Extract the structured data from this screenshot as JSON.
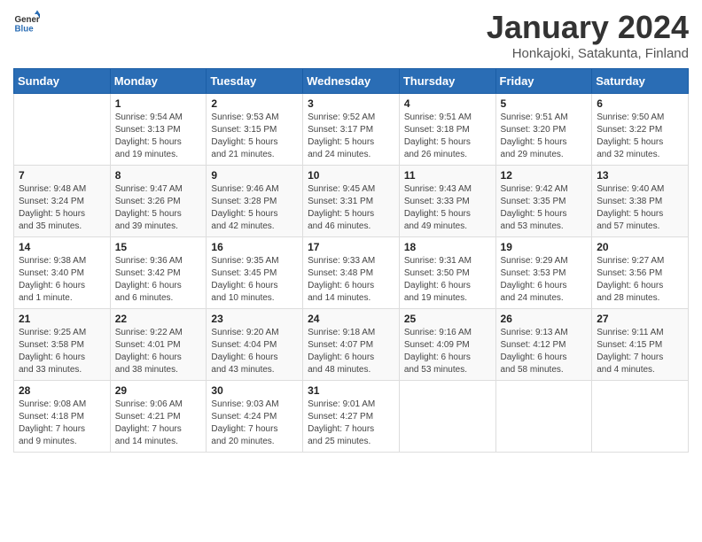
{
  "header": {
    "logo_general": "General",
    "logo_blue": "Blue",
    "title": "January 2024",
    "subtitle": "Honkajoki, Satakunta, Finland"
  },
  "calendar": {
    "days_of_week": [
      "Sunday",
      "Monday",
      "Tuesday",
      "Wednesday",
      "Thursday",
      "Friday",
      "Saturday"
    ],
    "weeks": [
      [
        {
          "day": "",
          "info": ""
        },
        {
          "day": "1",
          "info": "Sunrise: 9:54 AM\nSunset: 3:13 PM\nDaylight: 5 hours\nand 19 minutes."
        },
        {
          "day": "2",
          "info": "Sunrise: 9:53 AM\nSunset: 3:15 PM\nDaylight: 5 hours\nand 21 minutes."
        },
        {
          "day": "3",
          "info": "Sunrise: 9:52 AM\nSunset: 3:17 PM\nDaylight: 5 hours\nand 24 minutes."
        },
        {
          "day": "4",
          "info": "Sunrise: 9:51 AM\nSunset: 3:18 PM\nDaylight: 5 hours\nand 26 minutes."
        },
        {
          "day": "5",
          "info": "Sunrise: 9:51 AM\nSunset: 3:20 PM\nDaylight: 5 hours\nand 29 minutes."
        },
        {
          "day": "6",
          "info": "Sunrise: 9:50 AM\nSunset: 3:22 PM\nDaylight: 5 hours\nand 32 minutes."
        }
      ],
      [
        {
          "day": "7",
          "info": "Sunrise: 9:48 AM\nSunset: 3:24 PM\nDaylight: 5 hours\nand 35 minutes."
        },
        {
          "day": "8",
          "info": "Sunrise: 9:47 AM\nSunset: 3:26 PM\nDaylight: 5 hours\nand 39 minutes."
        },
        {
          "day": "9",
          "info": "Sunrise: 9:46 AM\nSunset: 3:28 PM\nDaylight: 5 hours\nand 42 minutes."
        },
        {
          "day": "10",
          "info": "Sunrise: 9:45 AM\nSunset: 3:31 PM\nDaylight: 5 hours\nand 46 minutes."
        },
        {
          "day": "11",
          "info": "Sunrise: 9:43 AM\nSunset: 3:33 PM\nDaylight: 5 hours\nand 49 minutes."
        },
        {
          "day": "12",
          "info": "Sunrise: 9:42 AM\nSunset: 3:35 PM\nDaylight: 5 hours\nand 53 minutes."
        },
        {
          "day": "13",
          "info": "Sunrise: 9:40 AM\nSunset: 3:38 PM\nDaylight: 5 hours\nand 57 minutes."
        }
      ],
      [
        {
          "day": "14",
          "info": "Sunrise: 9:38 AM\nSunset: 3:40 PM\nDaylight: 6 hours\nand 1 minute."
        },
        {
          "day": "15",
          "info": "Sunrise: 9:36 AM\nSunset: 3:42 PM\nDaylight: 6 hours\nand 6 minutes."
        },
        {
          "day": "16",
          "info": "Sunrise: 9:35 AM\nSunset: 3:45 PM\nDaylight: 6 hours\nand 10 minutes."
        },
        {
          "day": "17",
          "info": "Sunrise: 9:33 AM\nSunset: 3:48 PM\nDaylight: 6 hours\nand 14 minutes."
        },
        {
          "day": "18",
          "info": "Sunrise: 9:31 AM\nSunset: 3:50 PM\nDaylight: 6 hours\nand 19 minutes."
        },
        {
          "day": "19",
          "info": "Sunrise: 9:29 AM\nSunset: 3:53 PM\nDaylight: 6 hours\nand 24 minutes."
        },
        {
          "day": "20",
          "info": "Sunrise: 9:27 AM\nSunset: 3:56 PM\nDaylight: 6 hours\nand 28 minutes."
        }
      ],
      [
        {
          "day": "21",
          "info": "Sunrise: 9:25 AM\nSunset: 3:58 PM\nDaylight: 6 hours\nand 33 minutes."
        },
        {
          "day": "22",
          "info": "Sunrise: 9:22 AM\nSunset: 4:01 PM\nDaylight: 6 hours\nand 38 minutes."
        },
        {
          "day": "23",
          "info": "Sunrise: 9:20 AM\nSunset: 4:04 PM\nDaylight: 6 hours\nand 43 minutes."
        },
        {
          "day": "24",
          "info": "Sunrise: 9:18 AM\nSunset: 4:07 PM\nDaylight: 6 hours\nand 48 minutes."
        },
        {
          "day": "25",
          "info": "Sunrise: 9:16 AM\nSunset: 4:09 PM\nDaylight: 6 hours\nand 53 minutes."
        },
        {
          "day": "26",
          "info": "Sunrise: 9:13 AM\nSunset: 4:12 PM\nDaylight: 6 hours\nand 58 minutes."
        },
        {
          "day": "27",
          "info": "Sunrise: 9:11 AM\nSunset: 4:15 PM\nDaylight: 7 hours\nand 4 minutes."
        }
      ],
      [
        {
          "day": "28",
          "info": "Sunrise: 9:08 AM\nSunset: 4:18 PM\nDaylight: 7 hours\nand 9 minutes."
        },
        {
          "day": "29",
          "info": "Sunrise: 9:06 AM\nSunset: 4:21 PM\nDaylight: 7 hours\nand 14 minutes."
        },
        {
          "day": "30",
          "info": "Sunrise: 9:03 AM\nSunset: 4:24 PM\nDaylight: 7 hours\nand 20 minutes."
        },
        {
          "day": "31",
          "info": "Sunrise: 9:01 AM\nSunset: 4:27 PM\nDaylight: 7 hours\nand 25 minutes."
        },
        {
          "day": "",
          "info": ""
        },
        {
          "day": "",
          "info": ""
        },
        {
          "day": "",
          "info": ""
        }
      ]
    ]
  }
}
